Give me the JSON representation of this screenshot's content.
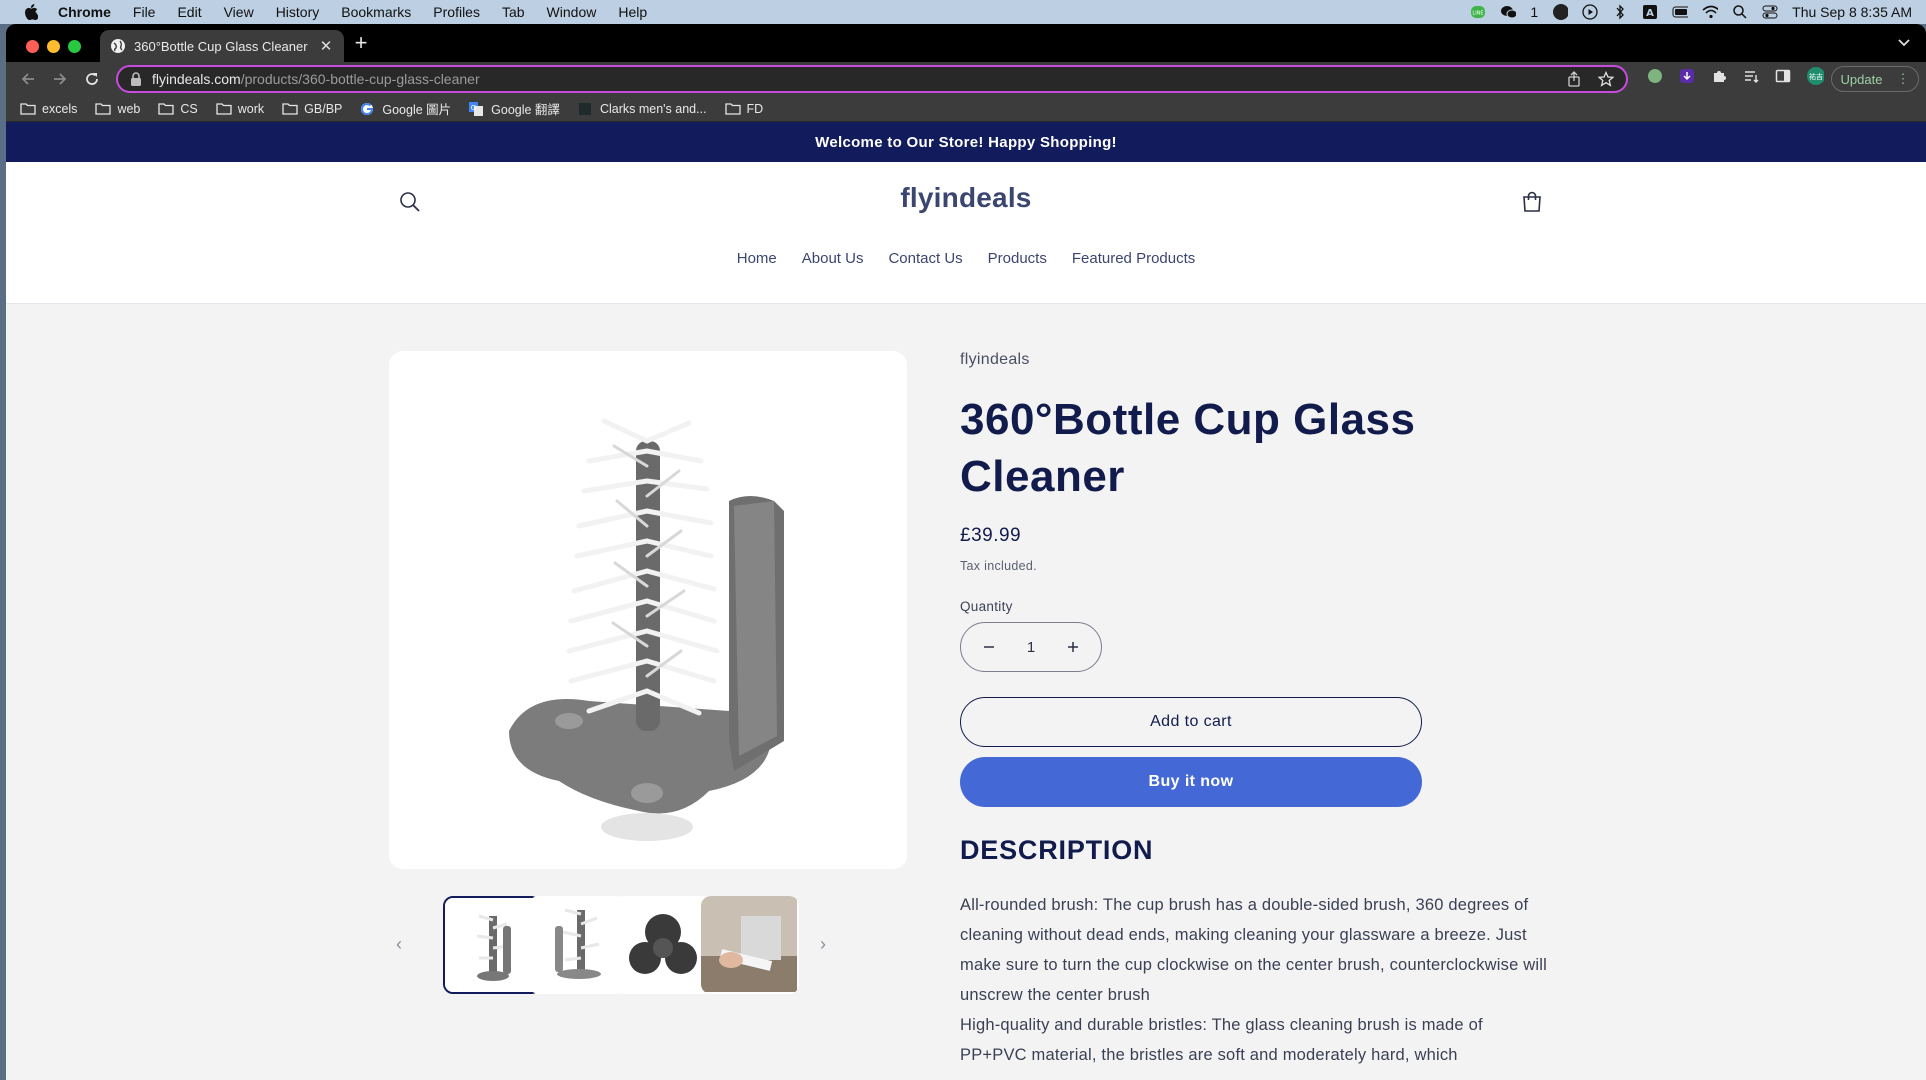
{
  "os_menubar": {
    "app_name": "Chrome",
    "menus": [
      "File",
      "Edit",
      "View",
      "History",
      "Bookmarks",
      "Profiles",
      "Tab",
      "Window",
      "Help"
    ],
    "wechat_count": "1",
    "datetime": "Thu Sep 8  8:35 AM"
  },
  "browser": {
    "tab_title": "360°Bottle Cup Glass Cleaner",
    "url_domain": "flyindeals.com",
    "url_path": "/products/360-bottle-cup-glass-cleaner",
    "update_label": "Update",
    "bookmarks": [
      {
        "label": "excels",
        "icon": "folder-icon"
      },
      {
        "label": "web",
        "icon": "folder-icon"
      },
      {
        "label": "CS",
        "icon": "folder-icon"
      },
      {
        "label": "work",
        "icon": "folder-icon"
      },
      {
        "label": "GB/BP",
        "icon": "folder-icon"
      },
      {
        "label": "Google 圖片",
        "icon": "google-icon"
      },
      {
        "label": "Google 翻譯",
        "icon": "translate-icon"
      },
      {
        "label": "Clarks men's and...",
        "icon": "clarks-icon"
      },
      {
        "label": "FD",
        "icon": "folder-icon"
      }
    ]
  },
  "store": {
    "announcement": "Welcome to Our Store! Happy Shopping!",
    "logo": "flyindeals",
    "nav": [
      "Home",
      "About Us",
      "Contact Us",
      "Products",
      "Featured Products"
    ]
  },
  "product": {
    "vendor": "flyindeals",
    "title": "360°Bottle Cup Glass Cleaner",
    "price": "£39.99",
    "tax_note": "Tax included.",
    "quantity_label": "Quantity",
    "quantity": "1",
    "add_to_cart": "Add to cart",
    "buy_now": "Buy it now",
    "description_heading": "DESCRIPTION",
    "description": "All-rounded brush: The cup brush has a double-sided brush, 360 degrees of cleaning without dead ends, making cleaning your glassware a breeze. Just make sure to turn the cup clockwise on the center brush, counterclockwise will unscrew the center brush\nHigh-quality and durable bristles: The glass cleaning brush is made of PP+PVC material, the bristles are soft and moderately hard, which"
  },
  "colors": {
    "announcement_bg": "#121c5c",
    "heading": "#121c4c",
    "buy_now_bg": "#4469d6",
    "page_bg": "#f3f3f4"
  }
}
